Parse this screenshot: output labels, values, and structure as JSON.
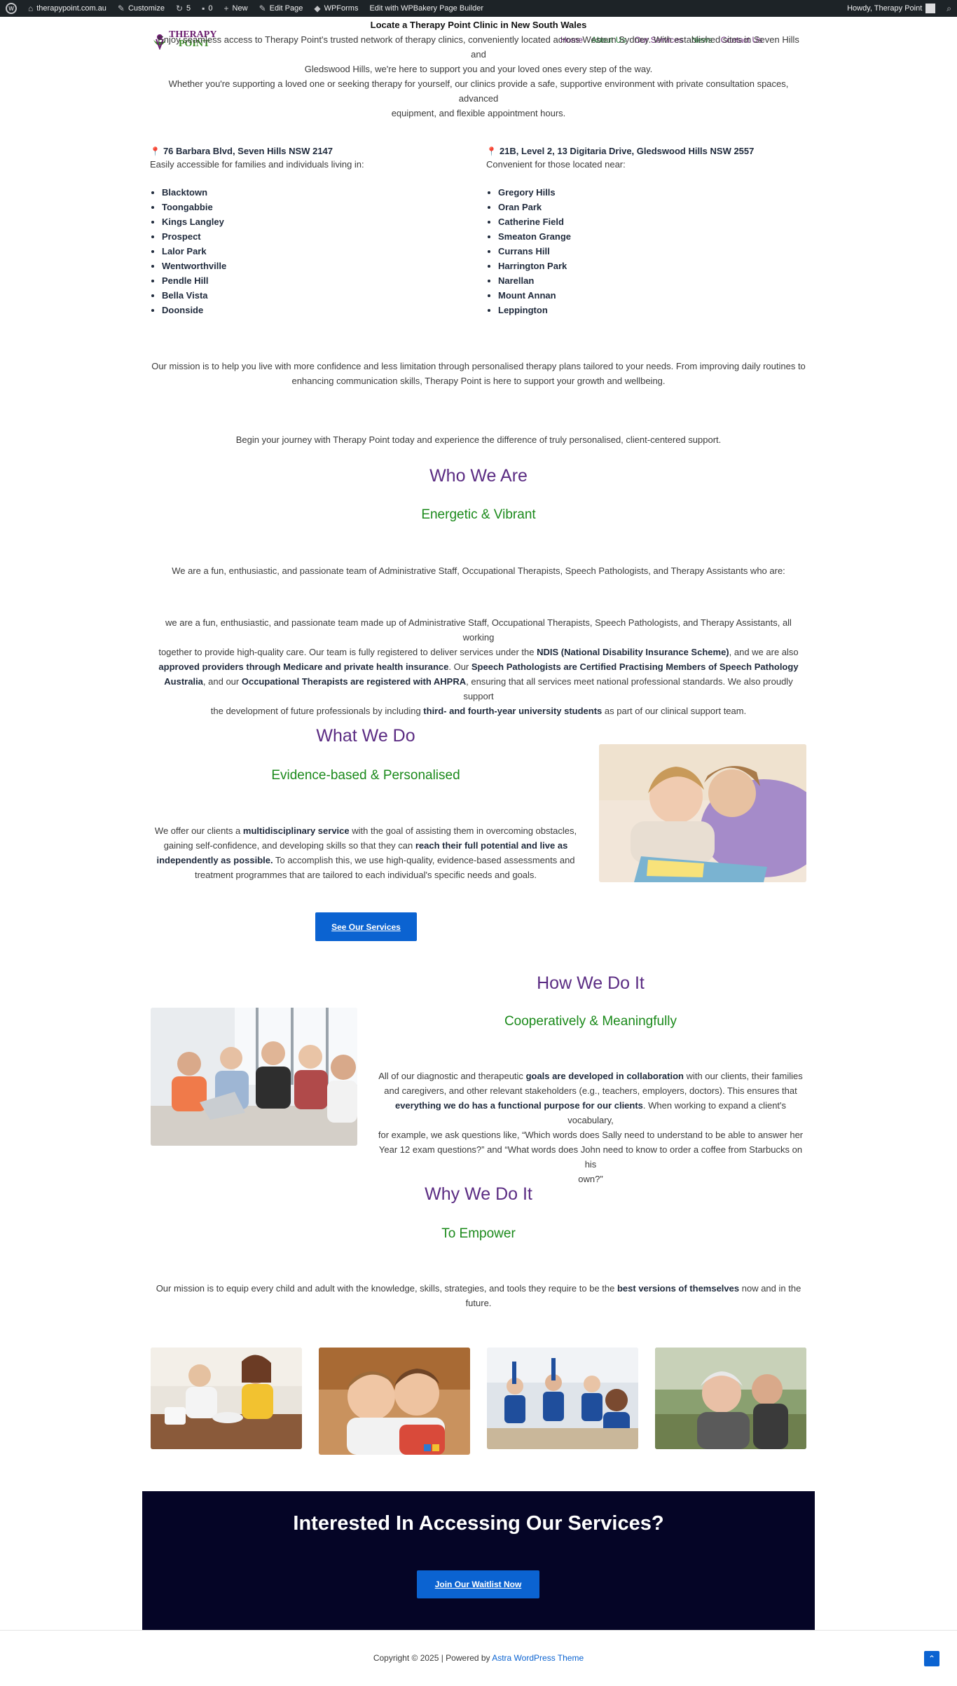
{
  "admin_bar": {
    "site": "therapypoint.com.au",
    "customize": "Customize",
    "updates": "5",
    "comments": "0",
    "new": "New",
    "edit_page": "Edit Page",
    "wpforms": "WPForms",
    "wpbakery": "Edit with WPBakery Page Builder",
    "howdy": "Howdy, Therapy Point"
  },
  "header": {
    "logo_line1": "THERAPY",
    "logo_line2": "POINT",
    "nav": [
      "Home",
      "About Us",
      "Our Services",
      "News",
      "Contact Us"
    ]
  },
  "locate": {
    "title": "Locate a Therapy Point Clinic in New South Wales",
    "intro_line1": "Enjoy seamless access to Therapy Point's trusted network of therapy clinics, conveniently located across Western Sydney. With established sites in Seven Hills and",
    "intro_line2": "Gledswood Hills, we're here to support you and your loved ones every step of the way.",
    "para2_line1": "Whether you're supporting a loved one or seeking therapy for yourself, our clinics provide a safe, supportive environment with private consultation spaces, advanced",
    "para2_line2": "equipment, and flexible appointment hours."
  },
  "clinics": [
    {
      "address": "76 Barbara Blvd, Seven Hills NSW 2147",
      "sub": "Easily accessible for families and individuals living in:",
      "suburbs": [
        "Blacktown",
        "Toongabbie",
        "Kings Langley",
        "Prospect",
        "Lalor Park",
        "Wentworthville",
        "Pendle Hill",
        "Bella Vista",
        "Doonside"
      ]
    },
    {
      "address": "21B, Level 2, 13 Digitaria Drive, Gledswood Hills NSW 2557",
      "sub": "Convenient for those located near:",
      "suburbs": [
        "Gregory Hills",
        "Oran Park",
        "Catherine Field",
        "Smeaton Grange",
        "Currans Hill",
        "Harrington Park",
        "Narellan",
        "Mount Annan",
        "Leppington"
      ]
    }
  ],
  "mission": {
    "line1": "Our mission is to help you live with more confidence and less limitation through personalised therapy plans tailored to your needs. From improving daily routines to",
    "line2": "enhancing communication skills, Therapy Point is here to support your growth and wellbeing.",
    "begin": "Begin your journey with Therapy Point today and experience the difference of truly personalised, client-centered support."
  },
  "who": {
    "title": "Who We Are",
    "subtitle": "Energetic & Vibrant",
    "lead": "We are a fun, enthusiastic, and passionate team of Administrative Staff, Occupational Therapists, Speech Pathologists, and Therapy Assistants who are:",
    "p_l1": "we are a fun, enthusiastic, and passionate team made up of Administrative Staff, Occupational Therapists, Speech Pathologists, and Therapy Assistants, all working",
    "p_l2a": "together to provide high-quality care. Our team is fully registered to deliver services under the ",
    "p_l2b": "NDIS (National Disability Insurance Scheme)",
    "p_l2c": ", and we are also",
    "p_l3a": "approved providers through Medicare and private health insurance",
    "p_l3b": ". Our ",
    "p_l3c": "Speech Pathologists are Certified Practising Members of Speech Pathology",
    "p_l4a": "Australia",
    "p_l4b": ", and our ",
    "p_l4c": "Occupational Therapists are registered with AHPRA",
    "p_l4d": ", ensuring that all services meet national professional standards. We also proudly support",
    "p_l5a": "the development of future professionals by including ",
    "p_l5b": "third- and fourth-year university students",
    "p_l5c": " as part of our clinical support team."
  },
  "what": {
    "title": "What We Do",
    "subtitle": "Evidence-based & Personalised",
    "l1a": "We offer our clients a ",
    "l1b": "multidisciplinary service",
    "l1c": " with the goal of assisting them in overcoming obstacles,",
    "l2a": "gaining self-confidence, and developing skills so that they can ",
    "l2b": "reach their full potential and live as",
    "l3a": "independently as possible.",
    "l3b": " To accomplish this, we use high-quality, evidence-based assessments and",
    "l4": "treatment programmes that are tailored to each individual's specific needs and goals.",
    "button": "See Our Services"
  },
  "how": {
    "title": "How We Do It",
    "subtitle": "Cooperatively & Meaningfully",
    "l1a": "All of our diagnostic and therapeutic ",
    "l1b": "goals are developed in collaboration",
    "l1c": " with our clients, their families",
    "l2": "and caregivers, and other relevant stakeholders (e.g., teachers, employers, doctors). This ensures that",
    "l3a": "everything we do has a functional purpose for our clients",
    "l3b": ". When working to expand a client's vocabulary,",
    "l4": "for example, we ask questions like, “Which words does Sally need to understand to be able to answer her",
    "l5": "Year 12 exam questions?” and “What words does John need to know to order a coffee from Starbucks on his",
    "l6": "own?”"
  },
  "why": {
    "title": "Why We Do It",
    "subtitle": "To Empower",
    "l1a": "Our mission is to equip every child and adult with the knowledge, skills, strategies, and tools they require to be the ",
    "l1b": "best versions of themselves",
    "l1c": " now and in the",
    "l2": "future."
  },
  "cta": {
    "title": "Interested In Accessing Our Services?",
    "button": "Join Our Waitlist Now"
  },
  "footer": {
    "text": "Copyright © 2025 | Powered by ",
    "link": "Astra WordPress Theme"
  },
  "colors": {
    "heading_purple": "#5b2c83",
    "subheading_green": "#1b8a1b",
    "button_blue": "#0b63d1",
    "cta_bg": "#050526"
  }
}
